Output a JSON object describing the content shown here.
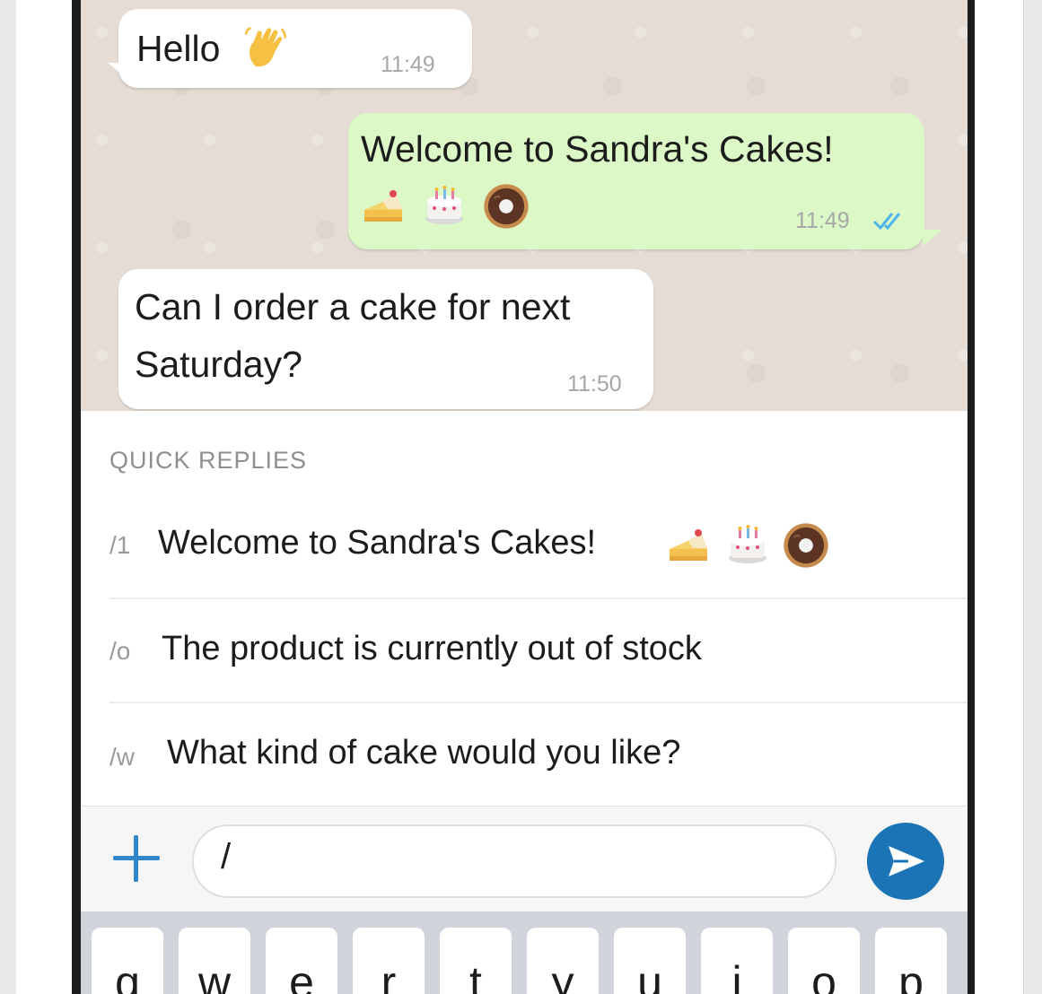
{
  "chat": {
    "messages": [
      {
        "direction": "incoming",
        "text": "Hello",
        "emoji": [
          "waving-hand"
        ],
        "time": "11:49"
      },
      {
        "direction": "outgoing",
        "text": "Welcome to Sandra's Cakes!",
        "emoji": [
          "shortcake",
          "birthday-cake",
          "doughnut"
        ],
        "time": "11:49",
        "status": "read"
      },
      {
        "direction": "incoming",
        "text_line1": "Can I order a cake for next",
        "text_line2": "Saturday?",
        "time": "11:50"
      }
    ]
  },
  "quick_replies": {
    "header": "QUICK REPLIES",
    "items": [
      {
        "shortcut": "/1",
        "text": "Welcome to Sandra's Cakes!",
        "emoji": [
          "shortcake",
          "birthday-cake",
          "doughnut"
        ]
      },
      {
        "shortcut": "/o",
        "text": "The product is currently out of stock"
      },
      {
        "shortcut": "/w",
        "text": "What kind of cake would you like?"
      }
    ]
  },
  "composer": {
    "value": "/",
    "icons": {
      "attach": "plus-icon",
      "send": "send-icon"
    },
    "accent": "#2f86c8",
    "send_color": "#1b74b5"
  },
  "keyboard": {
    "keys": [
      "q",
      "w",
      "e",
      "r",
      "t",
      "y",
      "u",
      "i",
      "o",
      "p"
    ]
  },
  "colors": {
    "chat_background": "#e5ddd5",
    "incoming_bubble": "#ffffff",
    "outgoing_bubble": "#dcf8c6",
    "read_ticks": "#4fb6ec"
  }
}
